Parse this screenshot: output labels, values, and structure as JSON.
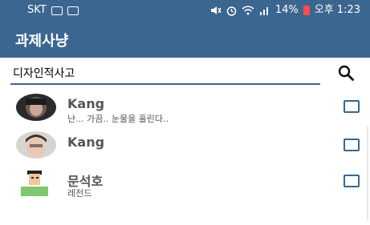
{
  "status_bar": {
    "carrier": "SKT",
    "battery": "14%",
    "time": "오후 1:23"
  },
  "app_bar": {
    "title": "과제사냥"
  },
  "search": {
    "value": "디자인적사고"
  },
  "contacts": [
    {
      "name": "Kang",
      "status": "난... 가끔.. 눈물을 흘린다..",
      "checked": false
    },
    {
      "name": "Kang",
      "status": "",
      "checked": false
    },
    {
      "name": "문석호",
      "status": "레전드",
      "checked": false
    }
  ],
  "colors": {
    "primary": "#3b6690",
    "text_secondary": "#555555"
  }
}
